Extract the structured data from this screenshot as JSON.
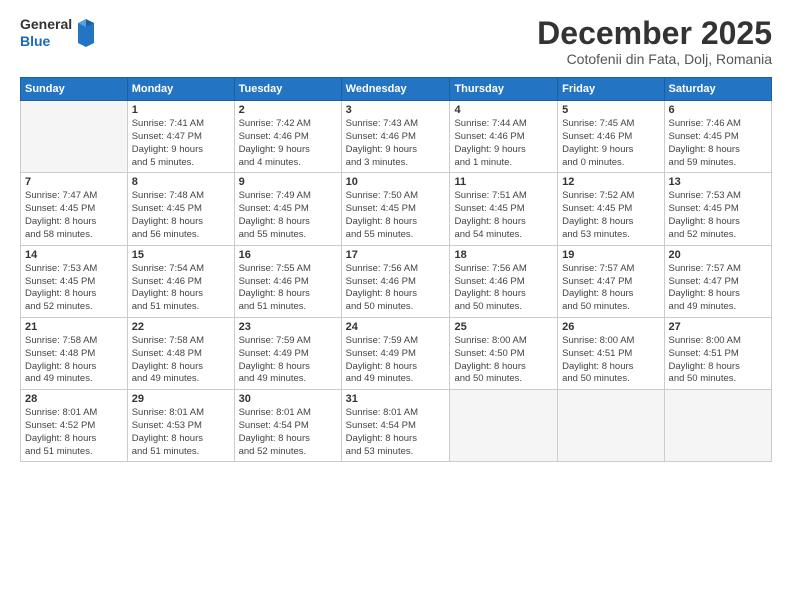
{
  "header": {
    "logo_general": "General",
    "logo_blue": "Blue",
    "title": "December 2025",
    "subtitle": "Cotofenii din Fata, Dolj, Romania"
  },
  "calendar": {
    "days_of_week": [
      "Sunday",
      "Monday",
      "Tuesday",
      "Wednesday",
      "Thursday",
      "Friday",
      "Saturday"
    ],
    "weeks": [
      [
        {
          "day": "",
          "info": ""
        },
        {
          "day": "1",
          "info": "Sunrise: 7:41 AM\nSunset: 4:47 PM\nDaylight: 9 hours\nand 5 minutes."
        },
        {
          "day": "2",
          "info": "Sunrise: 7:42 AM\nSunset: 4:46 PM\nDaylight: 9 hours\nand 4 minutes."
        },
        {
          "day": "3",
          "info": "Sunrise: 7:43 AM\nSunset: 4:46 PM\nDaylight: 9 hours\nand 3 minutes."
        },
        {
          "day": "4",
          "info": "Sunrise: 7:44 AM\nSunset: 4:46 PM\nDaylight: 9 hours\nand 1 minute."
        },
        {
          "day": "5",
          "info": "Sunrise: 7:45 AM\nSunset: 4:46 PM\nDaylight: 9 hours\nand 0 minutes."
        },
        {
          "day": "6",
          "info": "Sunrise: 7:46 AM\nSunset: 4:45 PM\nDaylight: 8 hours\nand 59 minutes."
        }
      ],
      [
        {
          "day": "7",
          "info": "Sunrise: 7:47 AM\nSunset: 4:45 PM\nDaylight: 8 hours\nand 58 minutes."
        },
        {
          "day": "8",
          "info": "Sunrise: 7:48 AM\nSunset: 4:45 PM\nDaylight: 8 hours\nand 56 minutes."
        },
        {
          "day": "9",
          "info": "Sunrise: 7:49 AM\nSunset: 4:45 PM\nDaylight: 8 hours\nand 55 minutes."
        },
        {
          "day": "10",
          "info": "Sunrise: 7:50 AM\nSunset: 4:45 PM\nDaylight: 8 hours\nand 55 minutes."
        },
        {
          "day": "11",
          "info": "Sunrise: 7:51 AM\nSunset: 4:45 PM\nDaylight: 8 hours\nand 54 minutes."
        },
        {
          "day": "12",
          "info": "Sunrise: 7:52 AM\nSunset: 4:45 PM\nDaylight: 8 hours\nand 53 minutes."
        },
        {
          "day": "13",
          "info": "Sunrise: 7:53 AM\nSunset: 4:45 PM\nDaylight: 8 hours\nand 52 minutes."
        }
      ],
      [
        {
          "day": "14",
          "info": "Sunrise: 7:53 AM\nSunset: 4:45 PM\nDaylight: 8 hours\nand 52 minutes."
        },
        {
          "day": "15",
          "info": "Sunrise: 7:54 AM\nSunset: 4:46 PM\nDaylight: 8 hours\nand 51 minutes."
        },
        {
          "day": "16",
          "info": "Sunrise: 7:55 AM\nSunset: 4:46 PM\nDaylight: 8 hours\nand 51 minutes."
        },
        {
          "day": "17",
          "info": "Sunrise: 7:56 AM\nSunset: 4:46 PM\nDaylight: 8 hours\nand 50 minutes."
        },
        {
          "day": "18",
          "info": "Sunrise: 7:56 AM\nSunset: 4:46 PM\nDaylight: 8 hours\nand 50 minutes."
        },
        {
          "day": "19",
          "info": "Sunrise: 7:57 AM\nSunset: 4:47 PM\nDaylight: 8 hours\nand 50 minutes."
        },
        {
          "day": "20",
          "info": "Sunrise: 7:57 AM\nSunset: 4:47 PM\nDaylight: 8 hours\nand 49 minutes."
        }
      ],
      [
        {
          "day": "21",
          "info": "Sunrise: 7:58 AM\nSunset: 4:48 PM\nDaylight: 8 hours\nand 49 minutes."
        },
        {
          "day": "22",
          "info": "Sunrise: 7:58 AM\nSunset: 4:48 PM\nDaylight: 8 hours\nand 49 minutes."
        },
        {
          "day": "23",
          "info": "Sunrise: 7:59 AM\nSunset: 4:49 PM\nDaylight: 8 hours\nand 49 minutes."
        },
        {
          "day": "24",
          "info": "Sunrise: 7:59 AM\nSunset: 4:49 PM\nDaylight: 8 hours\nand 49 minutes."
        },
        {
          "day": "25",
          "info": "Sunrise: 8:00 AM\nSunset: 4:50 PM\nDaylight: 8 hours\nand 50 minutes."
        },
        {
          "day": "26",
          "info": "Sunrise: 8:00 AM\nSunset: 4:51 PM\nDaylight: 8 hours\nand 50 minutes."
        },
        {
          "day": "27",
          "info": "Sunrise: 8:00 AM\nSunset: 4:51 PM\nDaylight: 8 hours\nand 50 minutes."
        }
      ],
      [
        {
          "day": "28",
          "info": "Sunrise: 8:01 AM\nSunset: 4:52 PM\nDaylight: 8 hours\nand 51 minutes."
        },
        {
          "day": "29",
          "info": "Sunrise: 8:01 AM\nSunset: 4:53 PM\nDaylight: 8 hours\nand 51 minutes."
        },
        {
          "day": "30",
          "info": "Sunrise: 8:01 AM\nSunset: 4:54 PM\nDaylight: 8 hours\nand 52 minutes."
        },
        {
          "day": "31",
          "info": "Sunrise: 8:01 AM\nSunset: 4:54 PM\nDaylight: 8 hours\nand 53 minutes."
        },
        {
          "day": "",
          "info": ""
        },
        {
          "day": "",
          "info": ""
        },
        {
          "day": "",
          "info": ""
        }
      ]
    ]
  }
}
